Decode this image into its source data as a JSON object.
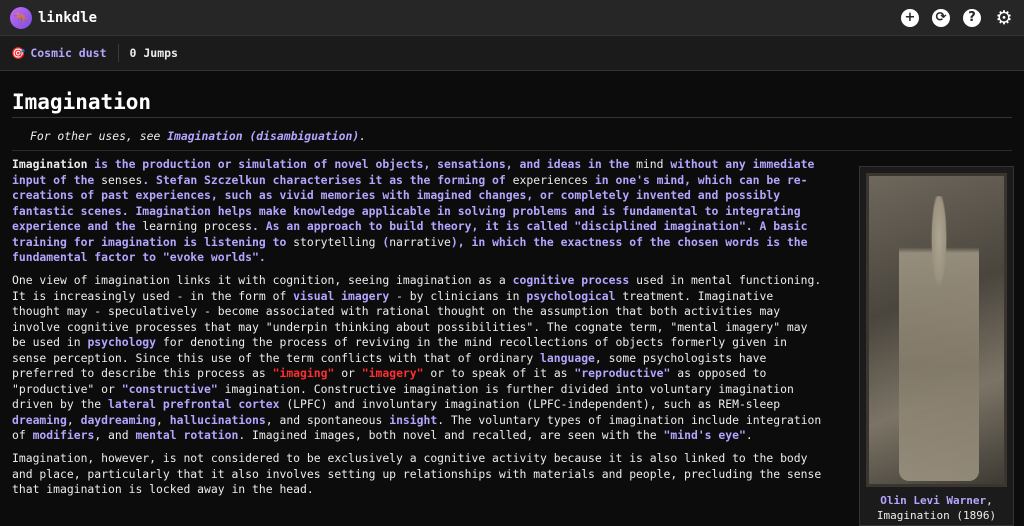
{
  "app": {
    "name": "linkdle"
  },
  "header_icons": [
    "plus-circle-icon",
    "refresh-icon",
    "help-icon",
    "gear-icon"
  ],
  "status": {
    "target": "Cosmic dust",
    "jumps": "0 Jumps"
  },
  "article": {
    "title": "Imagination",
    "hatnote": {
      "prefix": "For other uses, see ",
      "link": "Imagination (disambiguation)",
      "suffix": "."
    },
    "p1": [
      "Imagination",
      " is the production or simulation of novel objects, sensations, and ideas in the ",
      "mind",
      " without any immediate input of the ",
      "senses",
      ". Stefan Szczelkun characterises it as the forming of ",
      "experiences",
      " in one's mind, which can be re-creations of past experiences, such as vivid memories with imagined changes, or completely invented and possibly fantastic scenes. Imagination helps make knowledge applicable in solving problems and is fundamental to integrating experience and the ",
      "learning process",
      ". As an approach to build theory, it is called \"disciplined imagination\". A basic training for imagination is listening to ",
      "storytelling",
      " (",
      "narrative",
      "), in which the exactness of the chosen words is the fundamental factor to \"evoke worlds\"."
    ],
    "p2": [
      "One view of imagination links it with cognition, seeing imagination as a ",
      "cognitive process",
      " used in mental functioning. It is increasingly used - in the form of ",
      "visual imagery",
      " - by clinicians in ",
      "psychological",
      " treatment. Imaginative thought may - speculatively - become associated with rational thought on the assumption that both activities may involve cognitive processes that may \"underpin thinking about possibilities\". The cognate term, \"mental imagery\" may be used in ",
      "psychology",
      " for denoting the process of reviving in the mind recollections of objects formerly given in sense perception. Since this use of the term conflicts with that of ordinary ",
      "language",
      ", some psychologists have preferred to describe this process as ",
      "\"imaging\"",
      " or ",
      "\"imagery\"",
      " or to speak of it as ",
      "\"reproductive\"",
      " as opposed to \"productive\" or ",
      "\"constructive\"",
      " imagination. Constructive imagination is further divided into voluntary imagination driven by the ",
      "lateral prefrontal cortex",
      " (LPFC) and involuntary imagination (LPFC-independent), such as REM-sleep ",
      "dreaming",
      ", ",
      "daydreaming",
      ", ",
      "hallucinations",
      ", and spontaneous ",
      "insight",
      ". The voluntary types of imagination include integration of ",
      "modifiers",
      ", and ",
      "mental rotation",
      ". Imagined images, both novel and recalled, are seen with the ",
      "\"mind's eye\"",
      "."
    ],
    "p3": "Imagination, however, is not considered to be exclusively a cognitive activity because it is also linked to the body and place, particularly that it also involves setting up relationships with materials and people, precluding the sense that imagination is locked away in the head.",
    "figure": {
      "caption_link": "Olin Levi Warner",
      "caption_rest": ", Imagination (1896)"
    }
  },
  "colors": {
    "link": "#b3a6ff",
    "redlink": "#ff2f2f",
    "bg": "#0c0c0c"
  }
}
